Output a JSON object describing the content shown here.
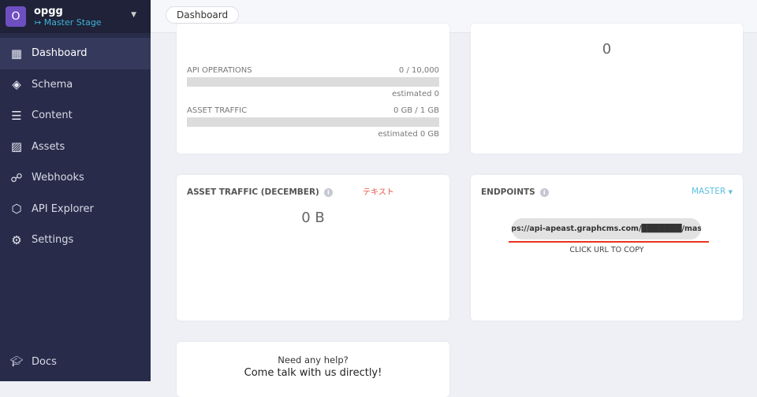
{
  "project": {
    "initial": "O",
    "name": "opgg",
    "stage": "Master Stage"
  },
  "nav": [
    {
      "label": "Dashboard",
      "icon": "dashboard-icon"
    },
    {
      "label": "Schema",
      "icon": "layers-icon"
    },
    {
      "label": "Content",
      "icon": "list-icon"
    },
    {
      "label": "Assets",
      "icon": "image-icon"
    },
    {
      "label": "Webhooks",
      "icon": "webhook-icon"
    },
    {
      "label": "API Explorer",
      "icon": "graphql-icon"
    },
    {
      "label": "Settings",
      "icon": "gear-icon"
    }
  ],
  "docs": "Docs",
  "breadcrumb": "Dashboard",
  "usage": {
    "api_label": "API OPERATIONS",
    "api_value": "0 / 10,000",
    "api_progress": 0,
    "api_est": "estimated 0",
    "traffic_label": "ASSET TRAFFIC",
    "traffic_value": "0 GB / 1 GB",
    "traffic_progress": 0,
    "traffic_est": "estimated 0 GB"
  },
  "top_right_value": "0",
  "asset_traffic": {
    "title": "ASSET TRAFFIC (DECEMBER)",
    "annotation": "テキスト",
    "value": "0 B"
  },
  "endpoints": {
    "title": "ENDPOINTS",
    "stage": "MASTER",
    "url": "https://api-apeast.graphcms.com/███████/master",
    "hint": "CLICK URL TO COPY"
  },
  "help": {
    "line1": "Need any help?",
    "line2": "Come talk with us directly!"
  }
}
